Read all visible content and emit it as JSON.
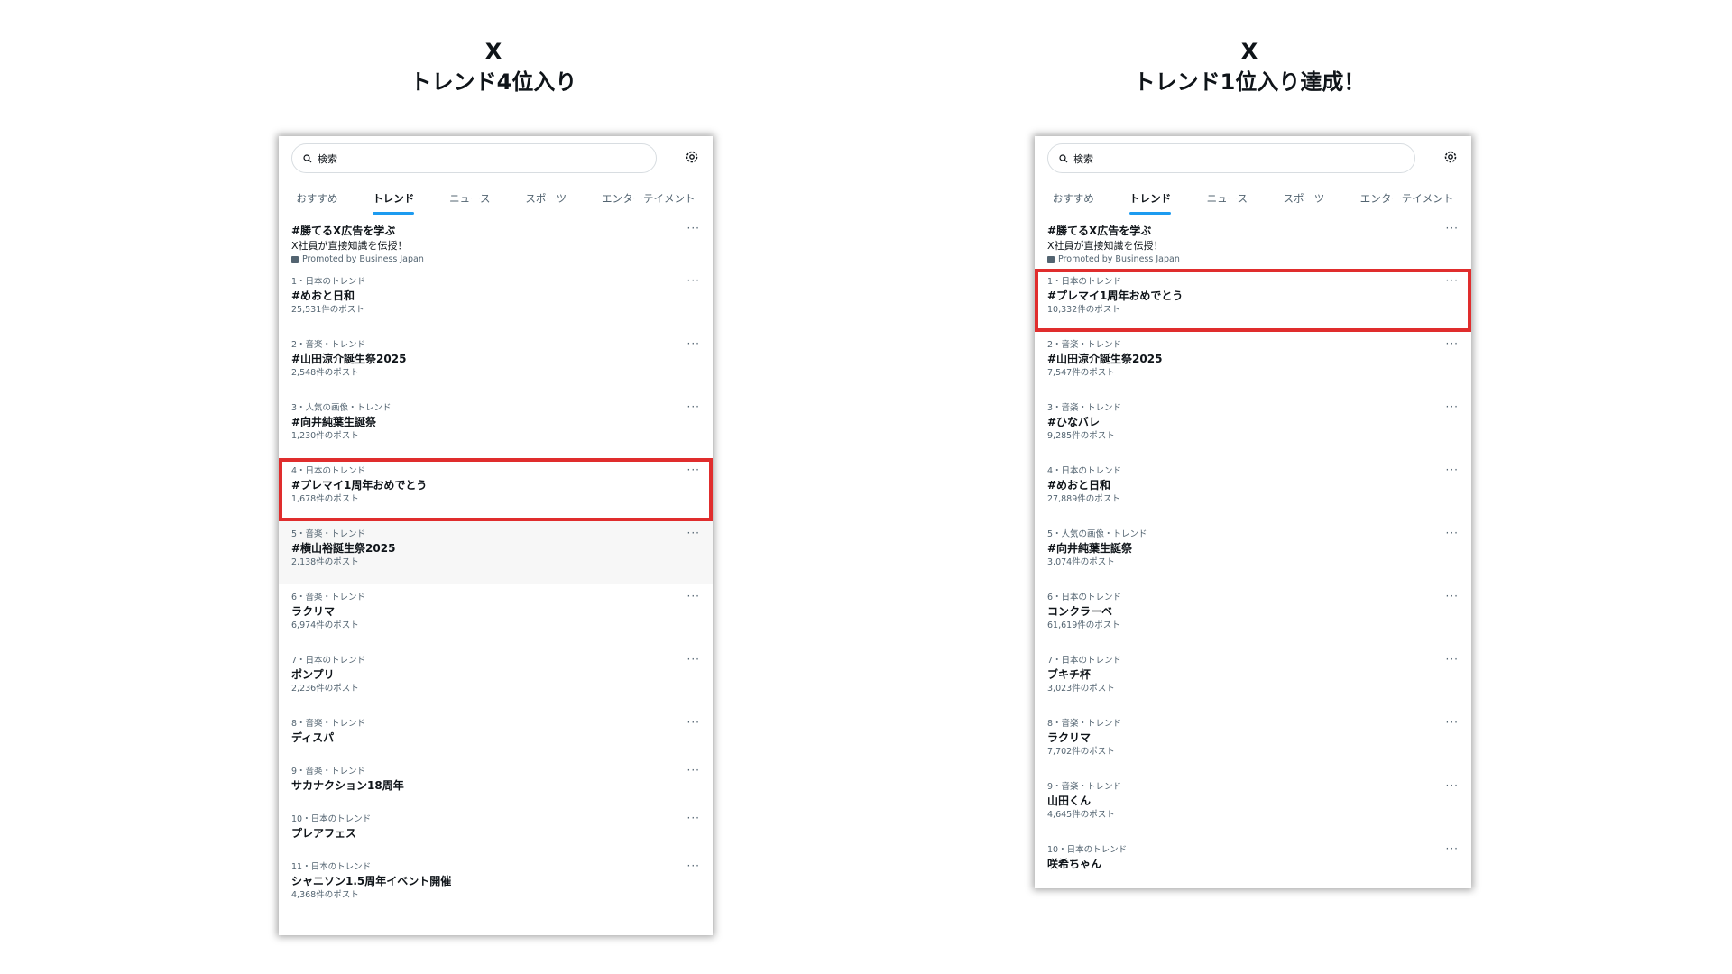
{
  "left": {
    "title_line1": "X",
    "title_line2": "トレンド4位入り",
    "search_placeholder": "検索",
    "tabs": [
      {
        "label": "おすすめ",
        "active": false
      },
      {
        "label": "トレンド",
        "active": true
      },
      {
        "label": "ニュース",
        "active": false
      },
      {
        "label": "スポーツ",
        "active": false
      },
      {
        "label": "エンターテイメント",
        "active": false
      }
    ],
    "promo": {
      "name": "#勝てるX広告を学ぶ",
      "desc": "X社員が直接知識を伝授！",
      "promoted": "Promoted by Business Japan"
    },
    "trends": [
      {
        "meta": "1・日本のトレンド",
        "name": "#めおと日和",
        "count": "25,531件のポスト"
      },
      {
        "meta": "2・音楽・トレンド",
        "name": "#山田涼介誕生祭2025",
        "count": "2,548件のポスト"
      },
      {
        "meta": "3・人気の画像・トレンド",
        "name": "#向井純葉生誕祭",
        "count": "1,230件のポスト"
      },
      {
        "meta": "4・日本のトレンド",
        "name": "#プレマイ1周年おめでとう",
        "count": "1,678件のポスト"
      },
      {
        "meta": "5・音楽・トレンド",
        "name": "#横山裕誕生祭2025",
        "count": "2,138件のポスト"
      },
      {
        "meta": "6・音楽・トレンド",
        "name": "ラクリマ",
        "count": "6,974件のポスト"
      },
      {
        "meta": "7・日本のトレンド",
        "name": "ポンプリ",
        "count": "2,236件のポスト"
      },
      {
        "meta": "8・音楽・トレンド",
        "name": "ディスパ",
        "count": ""
      },
      {
        "meta": "9・音楽・トレンド",
        "name": "サカナクション18周年",
        "count": ""
      },
      {
        "meta": "10・日本のトレンド",
        "name": "プレアフェス",
        "count": ""
      },
      {
        "meta": "11・日本のトレンド",
        "name": "シャニソン1.5周年イベント開催",
        "count": "4,368件のポスト"
      }
    ]
  },
  "right": {
    "title_line1": "X",
    "title_line2": "トレンド1位入り達成！",
    "search_placeholder": "検索",
    "tabs": [
      {
        "label": "おすすめ",
        "active": false
      },
      {
        "label": "トレンド",
        "active": true
      },
      {
        "label": "ニュース",
        "active": false
      },
      {
        "label": "スポーツ",
        "active": false
      },
      {
        "label": "エンターテイメント",
        "active": false
      }
    ],
    "promo": {
      "name": "#勝てるX広告を学ぶ",
      "desc": "X社員が直接知識を伝授！",
      "promoted": "Promoted by Business Japan"
    },
    "trends": [
      {
        "meta": "1・日本のトレンド",
        "name": "#プレマイ1周年おめでとう",
        "count": "10,332件のポスト"
      },
      {
        "meta": "2・音楽・トレンド",
        "name": "#山田涼介誕生祭2025",
        "count": "7,547件のポスト"
      },
      {
        "meta": "3・音楽・トレンド",
        "name": "#ひなバレ",
        "count": "9,285件のポスト"
      },
      {
        "meta": "4・日本のトレンド",
        "name": "#めおと日和",
        "count": "27,889件のポスト"
      },
      {
        "meta": "5・人気の画像・トレンド",
        "name": "#向井純葉生誕祭",
        "count": "3,074件のポスト"
      },
      {
        "meta": "6・日本のトレンド",
        "name": "コンクラーベ",
        "count": "61,619件のポスト"
      },
      {
        "meta": "7・日本のトレンド",
        "name": "ブキチ杯",
        "count": "3,023件のポスト"
      },
      {
        "meta": "8・音楽・トレンド",
        "name": "ラクリマ",
        "count": "7,702件のポスト"
      },
      {
        "meta": "9・音楽・トレンド",
        "name": "山田くん",
        "count": "4,645件のポスト"
      },
      {
        "meta": "10・日本のトレンド",
        "name": "咲希ちゃん",
        "count": ""
      }
    ]
  },
  "icons": {
    "search": "search-icon",
    "settings": "gear-icon",
    "more": "more-icon",
    "promoted": "promoted-icon"
  },
  "colors": {
    "highlight": "#e02d2d",
    "accent": "#1d9bf0",
    "text": "#0f1419",
    "muted": "#536471"
  }
}
